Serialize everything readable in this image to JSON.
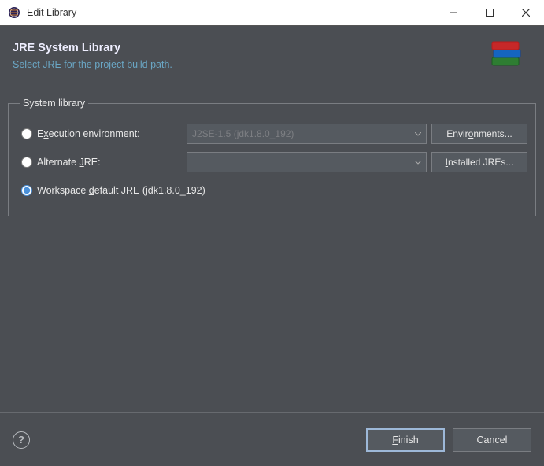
{
  "window": {
    "title": "Edit Library"
  },
  "header": {
    "title": "JRE System Library",
    "subtitle": "Select JRE for the project build path."
  },
  "group": {
    "legend": "System library",
    "exec_env_label_pre": "E",
    "exec_env_label_und": "x",
    "exec_env_label_post": "ecution environment:",
    "exec_env_value": "J2SE-1.5 (jdk1.8.0_192)",
    "environments_btn_pre": "Envir",
    "environments_btn_und": "o",
    "environments_btn_post": "nments...",
    "alt_jre_label_pre": "Alternate ",
    "alt_jre_label_und": "J",
    "alt_jre_label_post": "RE:",
    "alt_jre_value": "",
    "installed_btn_und": "I",
    "installed_btn_post": "nstalled JREs...",
    "workspace_label_pre": "Workspace ",
    "workspace_label_und": "d",
    "workspace_label_post": "efault JRE (jdk1.8.0_192)"
  },
  "footer": {
    "finish_und": "F",
    "finish_post": "inish",
    "cancel": "Cancel"
  }
}
